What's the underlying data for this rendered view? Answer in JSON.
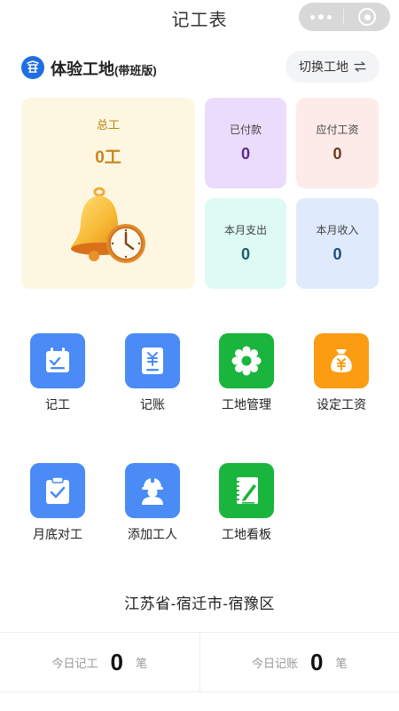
{
  "topbar": {
    "title": "记工表"
  },
  "site": {
    "name": "体验工地",
    "suffix": "(带班版)",
    "switch_label": "切换工地"
  },
  "stats": {
    "total": {
      "label": "总工",
      "value": "0工"
    },
    "paid": {
      "label": "已付款",
      "value": "0"
    },
    "payable": {
      "label": "应付工资",
      "value": "0"
    },
    "month_spend": {
      "label": "本月支出",
      "value": "0"
    },
    "month_income": {
      "label": "本月收入",
      "value": "0"
    }
  },
  "grid": {
    "record_work": "记工",
    "bookkeeping": "记账",
    "site_manage": "工地管理",
    "set_wage": "设定工资",
    "month_check": "月底对工",
    "add_worker": "添加工人",
    "site_board": "工地看板"
  },
  "location": "江苏省-宿迁市-宿豫区",
  "bottom": {
    "today_work": {
      "label": "今日记工",
      "value": "0",
      "unit": "笔"
    },
    "today_account": {
      "label": "今日记账",
      "value": "0",
      "unit": "笔"
    }
  },
  "colors": {
    "blue_tile": "#4a8bf5",
    "green_tile": "#19b53c",
    "orange_tile": "#fb9c12",
    "logo": "#1f6fe0"
  },
  "icons": [
    "more-icon",
    "close-circle-icon",
    "site-logo-icon",
    "switch-arrows-icon",
    "bell-clock-icon",
    "calendar-check-icon",
    "yuan-document-icon",
    "gear-icon",
    "money-bag-icon",
    "clipboard-check-icon",
    "worker-helmet-icon",
    "notebook-pen-icon"
  ]
}
